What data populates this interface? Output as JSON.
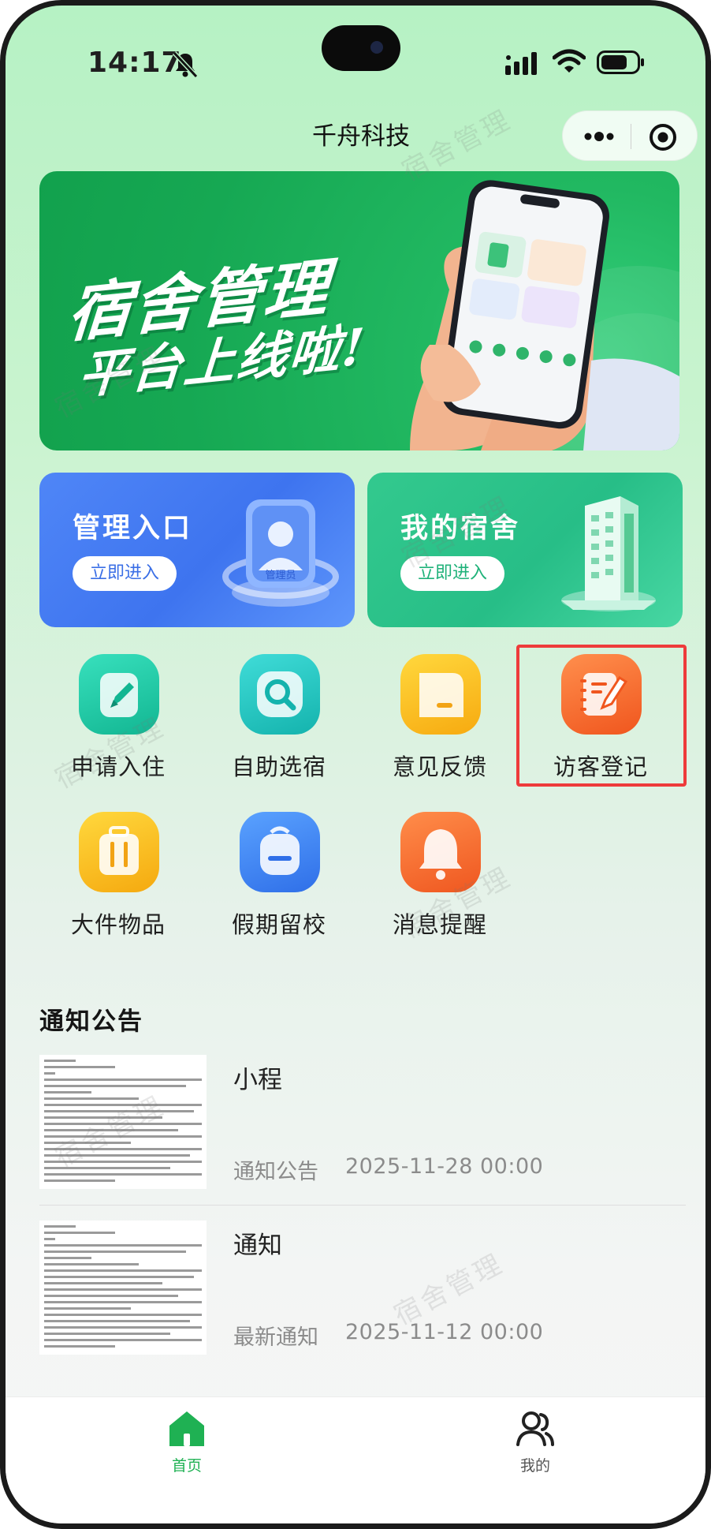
{
  "status_bar": {
    "time": "14:17"
  },
  "nav": {
    "title": "千舟科技"
  },
  "banner": {
    "line1": "宿舍管理",
    "line2": "平台上线啦!"
  },
  "entry_cards": [
    {
      "title": "管理入口",
      "button": "立即进入",
      "art_label": "管理员"
    },
    {
      "title": "我的宿舍",
      "button": "立即进入"
    }
  ],
  "grid": [
    {
      "label": "申请入住",
      "icon": "edit-icon"
    },
    {
      "label": "自助选宿",
      "icon": "search-icon"
    },
    {
      "label": "意见反馈",
      "icon": "feedback-icon"
    },
    {
      "label": "访客登记",
      "icon": "visitor-register-icon"
    },
    {
      "label": "大件物品",
      "icon": "luggage-icon"
    },
    {
      "label": "假期留校",
      "icon": "backpack-icon"
    },
    {
      "label": "消息提醒",
      "icon": "bell-icon"
    }
  ],
  "notices": {
    "section_title": "通知公告",
    "items": [
      {
        "title": "小程",
        "category": "通知公告",
        "date": "2025-11-28 00:00"
      },
      {
        "title": "通知",
        "category": "最新通知",
        "date": "2025-11-12 00:00"
      }
    ]
  },
  "watermark": "宿舍管理",
  "tabbar": {
    "home": "首页",
    "mine": "我的"
  },
  "colors": {
    "accent_green": "#1fb153",
    "highlight_red": "#ee3b3b",
    "manage_blue": "#3e74ef",
    "dorm_green": "#27be87"
  }
}
